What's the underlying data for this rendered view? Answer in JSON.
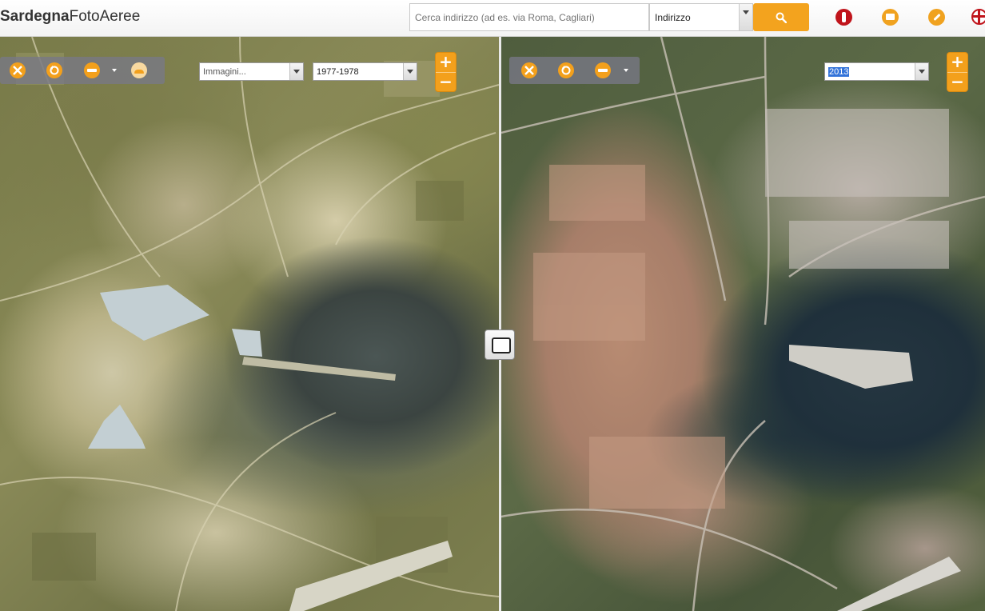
{
  "header": {
    "logo_bold": "Sardegna",
    "logo_thin": "FotoAeree",
    "search_placeholder": "Cerca indirizzo (ad es. via Roma, Cagliari)",
    "search_type": "Indirizzo",
    "icons": [
      "search-icon",
      "help-icon",
      "print-icon",
      "link-icon",
      "region-logo-icon"
    ],
    "accent_color": "#f3a31e"
  },
  "left_map": {
    "layer_select": "Immagini...",
    "year_select": "1977-1978",
    "zoom_in": "+",
    "zoom_out": "−",
    "tools": [
      "full-extent-icon",
      "zoom-previous-icon",
      "measure-icon",
      "layers-icon"
    ]
  },
  "right_map": {
    "year_select": "2013",
    "zoom_in": "+",
    "zoom_out": "−",
    "tools": [
      "full-extent-icon",
      "zoom-previous-icon",
      "measure-icon"
    ]
  }
}
